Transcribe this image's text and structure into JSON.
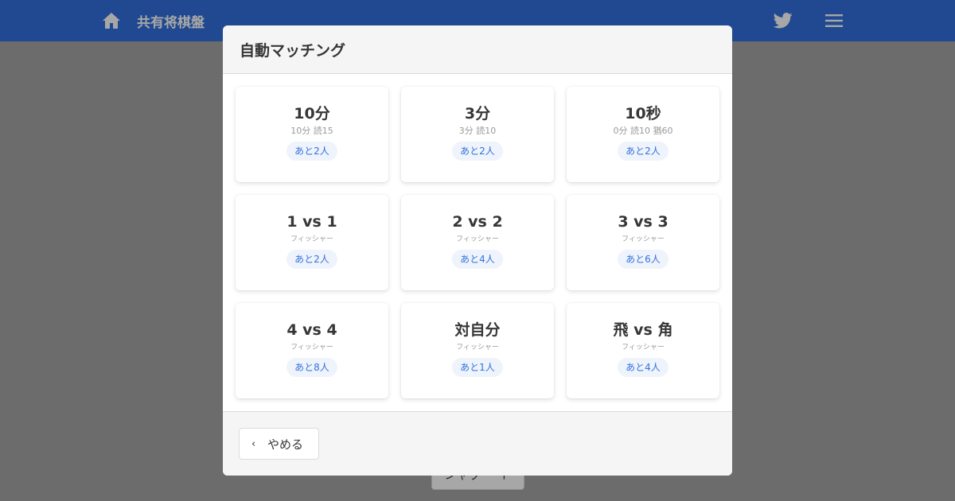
{
  "navbar": {
    "title": "共有将棋盤",
    "home_icon": "home-icon",
    "twitter_icon": "twitter-icon",
    "menu_icon": "menu-icon",
    "color": "#2d6cdf"
  },
  "background": {
    "button_label": "シャッ ー ト"
  },
  "modal": {
    "title": "自動マッチング",
    "cards": [
      {
        "title": "10分",
        "subtitle": "10分 読15",
        "tag": "あと2人"
      },
      {
        "title": "3分",
        "subtitle": "3分 読10",
        "tag": "あと2人"
      },
      {
        "title": "10秒",
        "subtitle": "0分 読10 猶60",
        "tag": "あと2人"
      },
      {
        "title": "1 vs 1",
        "subtitle": "フィッシャー",
        "tag": "あと2人"
      },
      {
        "title": "2 vs 2",
        "subtitle": "フィッシャー",
        "tag": "あと4人"
      },
      {
        "title": "3 vs 3",
        "subtitle": "フィッシャー",
        "tag": "あと6人"
      },
      {
        "title": "4 vs 4",
        "subtitle": "フィッシャー",
        "tag": "あと8人"
      },
      {
        "title": "対自分",
        "subtitle": "フィッシャー",
        "tag": "あと1人"
      },
      {
        "title": "飛 vs 角",
        "subtitle": "フィッシャー",
        "tag": "あと4人"
      }
    ],
    "footer": {
      "back_icon": "chevron-left-icon",
      "back_label": "やめる"
    }
  },
  "colors": {
    "accent": "#3273dc",
    "tag_bg": "#eef3fc"
  }
}
